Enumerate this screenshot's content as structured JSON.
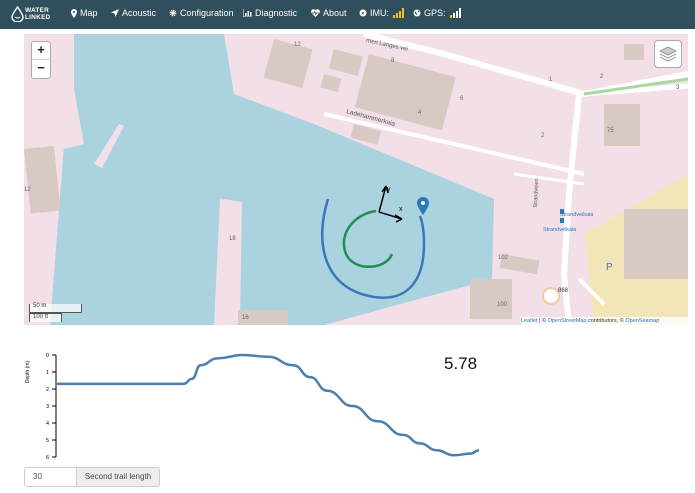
{
  "navbar": {
    "brand": {
      "line1": "WATER",
      "line2": "LINKED"
    },
    "items": [
      {
        "label": "Map",
        "icon": "map-marker-icon"
      },
      {
        "label": "Acoustic",
        "icon": "location-arrow-icon"
      },
      {
        "label": "Configuration",
        "icon": "gear-icon"
      },
      {
        "label": "Diagnostic",
        "icon": "bar-chart-icon"
      },
      {
        "label": "About",
        "icon": "heartbeat-icon"
      }
    ],
    "imu": {
      "label": "IMU:",
      "icon": "compass-icon",
      "signal_levels": 4,
      "signal_active": 4
    },
    "gps": {
      "label": "GPS:",
      "icon": "globe-icon",
      "signal_levels": 4,
      "signal_active": 4
    },
    "colors": {
      "background": "#2f4f5c",
      "signal": "#f0c420"
    }
  },
  "map": {
    "zoom_in": "+",
    "zoom_out": "−",
    "labels": {
      "street_top": "men Langes vei",
      "street_mid": "Ladehammerkaia",
      "street_right": "Strandveien",
      "bus_stop1": "Strandveikaia",
      "bus_stop2": "Strandveikaia",
      "parking": "P",
      "road_number": "868",
      "house_numbers": [
        "12",
        "8",
        "6",
        "4",
        "2",
        "1",
        "2",
        "3",
        "75",
        "18",
        "16",
        "102",
        "100",
        "12"
      ]
    },
    "axes": {
      "x": "x",
      "y": "y"
    },
    "scale": {
      "metric": "50 m",
      "imperial": "100 ft"
    },
    "attribution": {
      "leaflet": "Leaflet",
      "sep1": " | © ",
      "osm": "OpenStreetMap",
      "contrib": " contributors, © ",
      "seamap": "OpenSeamap"
    },
    "colors": {
      "water": "#aad3df",
      "land": "#f2dfe8",
      "track_rov": "#1e8f4e",
      "track_topside": "#3a78b5",
      "marker": "#2a7ab8"
    }
  },
  "depth_chart": {
    "ylabel": "Depth (m)",
    "yticks": [
      "0",
      "1",
      "2",
      "3",
      "4",
      "5",
      "6"
    ],
    "current_value": "5.78",
    "line_color": "#4a7fb0",
    "chart_data": {
      "type": "line",
      "xlabel": "",
      "ylabel": "Depth (m)",
      "ylim": [
        0,
        6
      ],
      "y_inverted": true,
      "series": [
        {
          "x": [
            0,
            8,
            16,
            24,
            30,
            32,
            34,
            38,
            44,
            50,
            56,
            60,
            64,
            70,
            76,
            82,
            86,
            90,
            94,
            98,
            100
          ],
          "y": [
            1.7,
            1.7,
            1.7,
            1.7,
            1.7,
            1.4,
            0.6,
            0.2,
            0.0,
            0.1,
            0.6,
            1.3,
            2.1,
            3.0,
            3.9,
            4.7,
            5.2,
            5.6,
            5.9,
            5.8,
            5.6
          ]
        }
      ]
    }
  },
  "trail": {
    "value": "30",
    "label": "Second trail length"
  }
}
